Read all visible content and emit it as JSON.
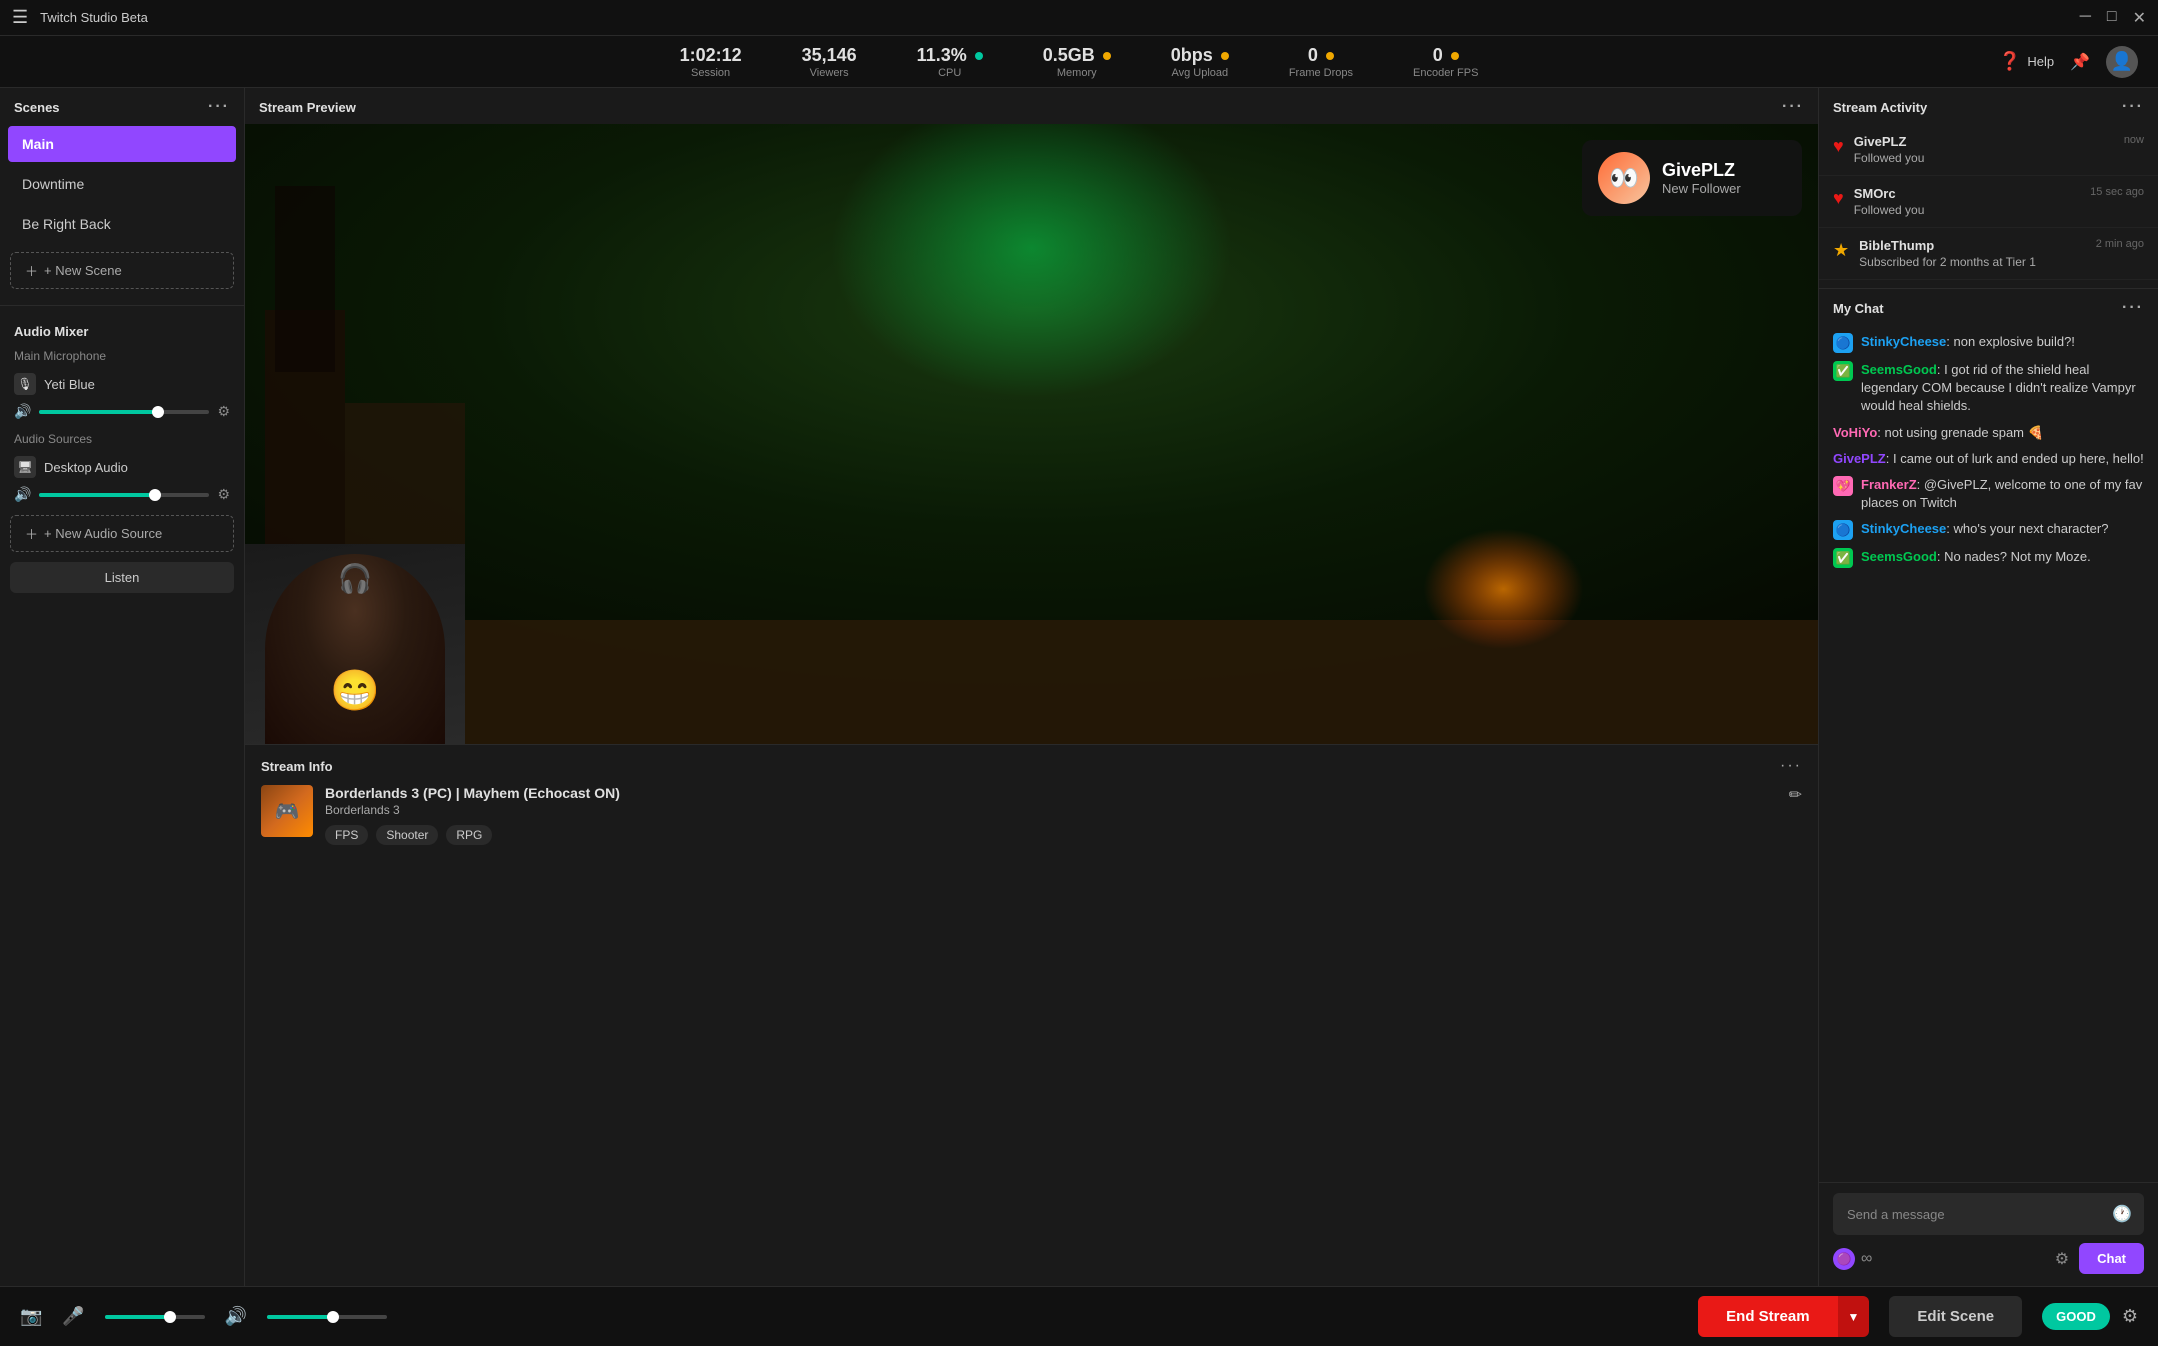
{
  "titleBar": {
    "title": "Twitch Studio Beta",
    "menuIcon": "☰",
    "controls": [
      "─",
      "□",
      "✕"
    ]
  },
  "stats": [
    {
      "id": "session",
      "value": "1:02:12",
      "label": "Session",
      "dot": null
    },
    {
      "id": "viewers",
      "value": "35,146",
      "label": "Viewers",
      "dot": null
    },
    {
      "id": "cpu",
      "value": "11.3%",
      "label": "CPU",
      "dot": "green"
    },
    {
      "id": "memory",
      "value": "0.5GB",
      "label": "Memory",
      "dot": "yellow"
    },
    {
      "id": "avgUpload",
      "value": "0bps",
      "label": "Avg Upload",
      "dot": "yellow"
    },
    {
      "id": "frameDrops",
      "value": "0",
      "label": "Frame Drops",
      "dot": "yellow"
    },
    {
      "id": "encoderFPS",
      "value": "0",
      "label": "Encoder FPS",
      "dot": "yellow"
    }
  ],
  "helpLabel": "Help",
  "scenes": {
    "sectionLabel": "Scenes",
    "items": [
      {
        "id": "main",
        "label": "Main",
        "active": true
      },
      {
        "id": "downtime",
        "label": "Downtime",
        "active": false
      },
      {
        "id": "beRightBack",
        "label": "Be Right Back",
        "active": false
      }
    ],
    "newSceneLabel": "+ New Scene"
  },
  "audioMixer": {
    "sectionLabel": "Audio Mixer",
    "microphone": {
      "subLabel": "Main Microphone",
      "deviceName": "Yeti Blue",
      "volumePercent": 70
    },
    "audioSources": {
      "subLabel": "Audio Sources",
      "deviceName": "Desktop Audio",
      "volumePercent": 68
    },
    "newAudioSourceLabel": "+ New Audio Source",
    "listenLabel": "Listen"
  },
  "streamPreview": {
    "sectionLabel": "Stream Preview",
    "followerNotification": {
      "name": "GivePLZ",
      "label": "New Follower",
      "emoji": "👀"
    }
  },
  "streamInfo": {
    "sectionLabel": "Stream Info",
    "title": "Borderlands 3 (PC) | Mayhem (Echocast ON)",
    "game": "Borderlands 3",
    "tags": [
      "FPS",
      "Shooter",
      "RPG"
    ]
  },
  "streamActivity": {
    "sectionLabel": "Stream Activity",
    "items": [
      {
        "id": "givepl",
        "name": "GivePLZ",
        "action": "Followed you",
        "time": "now",
        "icon": "♥",
        "iconColor": "#e91916"
      },
      {
        "id": "smorc",
        "name": "SMOrc",
        "action": "Followed you",
        "time": "15 sec ago",
        "icon": "♥",
        "iconColor": "#e91916"
      },
      {
        "id": "biblethump",
        "name": "BibleThump",
        "action": "Subscribed for 2 months at Tier 1",
        "time": "2 min ago",
        "icon": "★",
        "iconColor": "#f0a800"
      }
    ]
  },
  "chat": {
    "sectionLabel": "My Chat",
    "messages": [
      {
        "id": 1,
        "badge": "🔵",
        "username": "StinkyCheese",
        "usernameColor": "#1da1f2",
        "text": "non explosive build?!",
        "badgeBg": "#1da1f2"
      },
      {
        "id": 2,
        "badge": "✅",
        "username": "SeemsGood",
        "usernameColor": "#00c851",
        "text": "I got rid of the shield heal legendary COM because I didn't realize Vampyr would heal shields.",
        "badgeBg": "#00c851"
      },
      {
        "id": 3,
        "badge": null,
        "username": "VoHiYo",
        "usernameColor": "#ff69b4",
        "text": "not using grenade spam 🍕",
        "badgeBg": null
      },
      {
        "id": 4,
        "badge": null,
        "username": "GivePLZ",
        "usernameColor": "#9147ff",
        "text": "I came out of lurk and ended up here, hello!",
        "badgeBg": null
      },
      {
        "id": 5,
        "badge": "💖",
        "username": "FrankerZ",
        "usernameColor": "#ff69b4",
        "text": "@GivePLZ, welcome to one of my fav places on Twitch",
        "badgeBg": "#ff69b4"
      },
      {
        "id": 6,
        "badge": "🔵",
        "username": "StinkyCheese",
        "usernameColor": "#1da1f2",
        "text": "who's your next character?",
        "badgeBg": "#1da1f2"
      },
      {
        "id": 7,
        "badge": "✅",
        "username": "SeemsGood",
        "usernameColor": "#00c851",
        "text": "No nades? Not my Moze.",
        "badgeBg": "#00c851"
      }
    ],
    "inputPlaceholder": "Send a message",
    "sendLabel": "Chat"
  },
  "bottomBar": {
    "endStreamLabel": "End Stream",
    "editSceneLabel": "Edit Scene",
    "goodBadge": "GOOD"
  }
}
